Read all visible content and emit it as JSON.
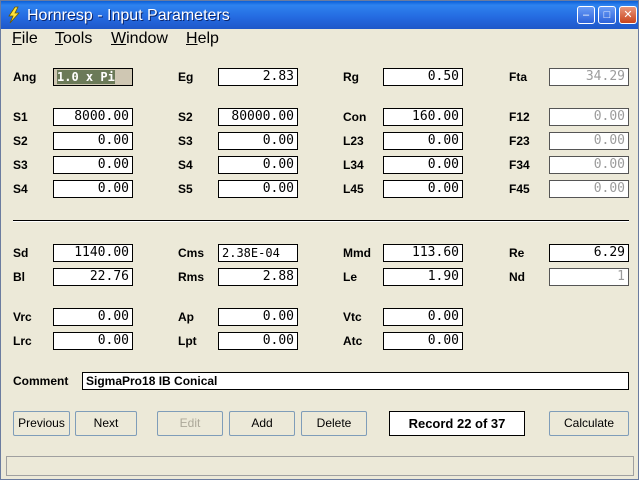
{
  "window": {
    "title": "Hornresp - Input Parameters",
    "min_glyph": "–",
    "max_glyph": "□",
    "close_glyph": "✕"
  },
  "menu": [
    "File",
    "Tools",
    "Window",
    "Help"
  ],
  "menu_underline": [
    "F",
    "T",
    "W",
    "H"
  ],
  "fields": {
    "Ang": "1.0 x Pi",
    "Eg": "2.83",
    "Rg": "0.50",
    "Fta": "34.29",
    "S1": "8000.00",
    "S2a": "80000.00",
    "Con": "160.00",
    "F12": "0.00",
    "S2": "0.00",
    "S3a": "0.00",
    "L23": "0.00",
    "F23": "0.00",
    "S3": "0.00",
    "S4a": "0.00",
    "L34": "0.00",
    "F34": "0.00",
    "S4": "0.00",
    "S5": "0.00",
    "L45": "0.00",
    "F45": "0.00",
    "Sd": "1140.00",
    "Cms": "2.38E-04",
    "Mmd": "113.60",
    "Re": "6.29",
    "Bl": "22.76",
    "Rms": "2.88",
    "Le": "1.90",
    "Nd": "1",
    "Vrc": "0.00",
    "Ap": "0.00",
    "Vtc": "0.00",
    "Lrc": "0.00",
    "Lpt": "0.00",
    "Atc": "0.00"
  },
  "labels": {
    "Ang": "Ang",
    "Eg": "Eg",
    "Rg": "Rg",
    "Fta": "Fta",
    "S1": "S1",
    "S2a": "S2",
    "Con": "Con",
    "F12": "F12",
    "S2": "S2",
    "S3a": "S3",
    "L23": "L23",
    "F23": "F23",
    "S3": "S3",
    "S4a": "S4",
    "L34": "L34",
    "F34": "F34",
    "S4": "S4",
    "S5": "S5",
    "L45": "L45",
    "F45": "F45",
    "Sd": "Sd",
    "Cms": "Cms",
    "Mmd": "Mmd",
    "Re": "Re",
    "Bl": "Bl",
    "Rms": "Rms",
    "Le": "Le",
    "Nd": "Nd",
    "Vrc": "Vrc",
    "Ap": "Ap",
    "Vtc": "Vtc",
    "Lrc": "Lrc",
    "Lpt": "Lpt",
    "Atc": "Atc",
    "Comment": "Comment"
  },
  "comment": "SigmaPro18 IB Conical",
  "buttons": {
    "previous": "Previous",
    "next": "Next",
    "edit": "Edit",
    "add": "Add",
    "delete": "Delete",
    "calculate": "Calculate"
  },
  "record": "Record 22 of 37"
}
